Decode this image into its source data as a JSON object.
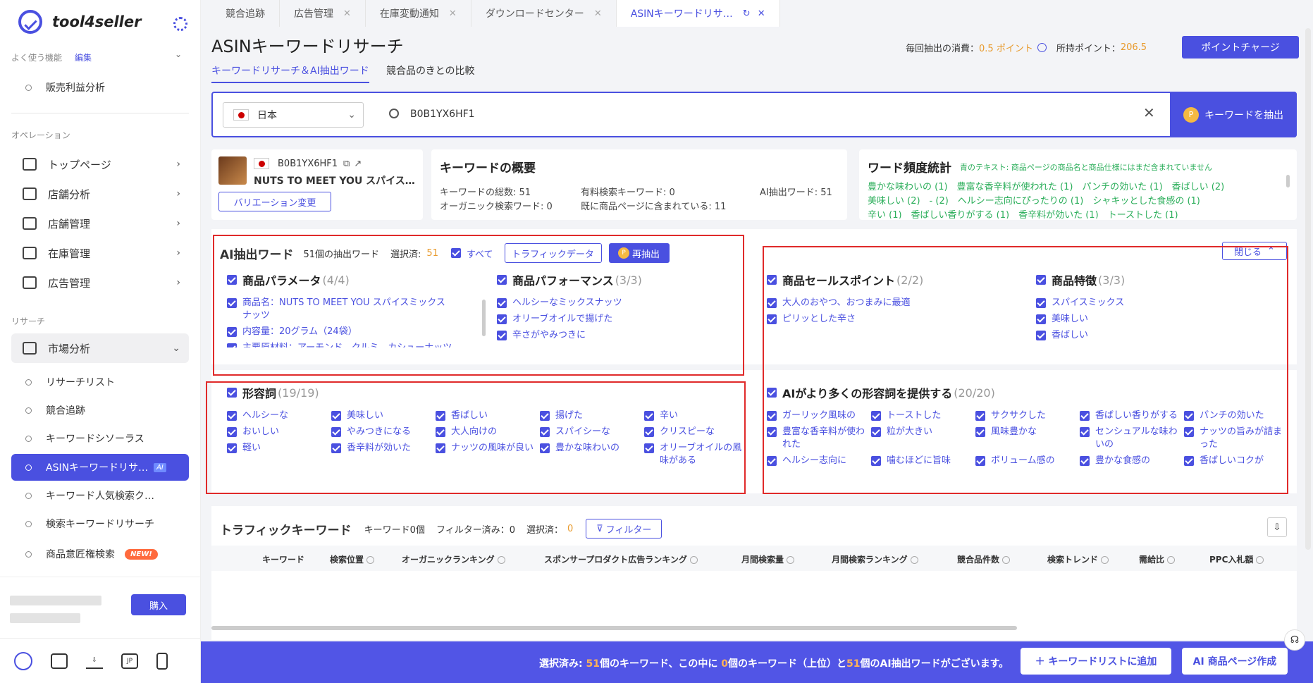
{
  "app": {
    "name": "tool4seller"
  },
  "sidebar": {
    "favorites_label": "よく使う機能",
    "edit_label": "編集",
    "fav_items": [
      {
        "label": "販売利益分析"
      }
    ],
    "operation_label": "オペレーション",
    "op_items": [
      {
        "label": "トップページ",
        "icon": "home-icon"
      },
      {
        "label": "店舗分析",
        "icon": "chart-icon"
      },
      {
        "label": "店舗管理",
        "icon": "store-icon"
      },
      {
        "label": "在庫管理",
        "icon": "box-icon"
      },
      {
        "label": "広告管理",
        "icon": "monitor-icon"
      }
    ],
    "research_label": "リサーチ",
    "market_label": "市場分析",
    "research_items": [
      {
        "label": "リサーチリスト"
      },
      {
        "label": "競合追跡"
      },
      {
        "label": "キーワードシソーラス"
      },
      {
        "label": "ASINキーワードリサ…",
        "tag": "AI"
      },
      {
        "label": "キーワード人気検索ク…"
      },
      {
        "label": "検索キーワードリサーチ"
      },
      {
        "label": "商品意匠権検索",
        "tag": "NEW!"
      }
    ],
    "buy_label": "購入",
    "lang_label": "JP"
  },
  "tabs": [
    {
      "label": "競合追跡"
    },
    {
      "label": "広告管理"
    },
    {
      "label": "在庫変動通知"
    },
    {
      "label": "ダウンロードセンター"
    },
    {
      "label": "ASINキーワードリサ…"
    }
  ],
  "header": {
    "title": "ASINキーワードリサーチ",
    "subtabs": [
      "キーワードリサーチ＆AI抽出ワード",
      "競合品のきとの比較"
    ],
    "cost_label": "毎回抽出の消費：",
    "cost_value": "0.5 ポイント",
    "own_label": "所持ポイント：",
    "own_value": "206.5",
    "charge_label": "ポイントチャージ"
  },
  "search": {
    "country": "日本",
    "query": "B0B1YX6HF1",
    "extract_label": "キーワードを抽出"
  },
  "product": {
    "asin": "B0B1YX6HF1",
    "name": "NUTS TO MEET YOU スパイス…",
    "variation_label": "バリエーション変更"
  },
  "overview": {
    "title": "キーワードの概要",
    "total_label": "キーワードの総数:",
    "total": "51",
    "paid_label": "有料検索キーワード:",
    "paid": "0",
    "ai_label": "AI抽出ワード:",
    "ai": "51",
    "organic_label": "オーガニック検索ワード:",
    "organic": "0",
    "included_label": "既に商品ページに含まれている:",
    "included": "11"
  },
  "freq": {
    "title": "ワード頻度統計",
    "note": "青のテキスト: 商品ページの商品名と商品仕様にはまだ含まれていません",
    "rows": [
      "豊かな味わいの (1)　豊富な香辛料が使われた (1)　パンチの効いた (1)　香ばしい (2)",
      "美味しい (2)　- (2)　ヘルシー志向にぴったりの (1)　シャキッとした食感の (1)",
      "辛い (1)　香ばしい香りがする (1)　香辛料が効いた (1)　トーストした (1)"
    ]
  },
  "ai": {
    "title": "AI抽出ワード",
    "count_label": "51個の抽出ワード",
    "selected_label": "選択済:",
    "selected": "51",
    "all_label": "すべて",
    "traffic_btn": "トラフィックデータ",
    "reextract_btn": "再抽出",
    "close_label": "閉じる"
  },
  "panels": {
    "params": {
      "title": "商品パラメータ",
      "count": "(4/4)",
      "items": [
        "商品名：NUTS TO MEET YOU スパイスミックスナッツ",
        "内容量：20グラム（24袋）",
        "主要原材料：アーモンド、クルミ、カシューナッツ"
      ]
    },
    "perf": {
      "title": "商品パフォーマンス",
      "count": "(3/3)",
      "items": [
        "ヘルシーなミックスナッツ",
        "オリーブオイルで揚げた",
        "辛さがやみつきに"
      ]
    },
    "sales": {
      "title": "商品セールスポイント",
      "count": "(2/2)",
      "items": [
        "大人のおやつ、おつまみに最適",
        "ピリッとした辛さ"
      ]
    },
    "feat": {
      "title": "商品特徴",
      "count": "(3/3)",
      "items": [
        "スパイスミックス",
        "美味しい",
        "香ばしい"
      ]
    },
    "adj": {
      "title": "形容詞",
      "count": "(19/19)",
      "items": [
        "ヘルシーな",
        "美味しい",
        "香ばしい",
        "揚げた",
        "辛い",
        "おいしい",
        "やみつきになる",
        "大人向けの",
        "スパイシーな",
        "クリスピーな",
        "軽い",
        "香辛料が効いた",
        "ナッツの風味が良い",
        "豊かな味わいの",
        "オリーブオイルの風味がある"
      ]
    },
    "aiadj": {
      "title": "AIがより多くの形容詞を提供する",
      "count": "(20/20)",
      "items": [
        "ガーリック風味の",
        "トーストした",
        "サクサクした",
        "香ばしい香りがする",
        "パンチの効いた",
        "豊富な香辛料が使われた",
        "粒が大きい",
        "風味豊かな",
        "センシュアルな味わいの",
        "ナッツの旨みが詰まった",
        "ヘルシー志向に",
        "噛むほどに旨味",
        "ボリューム感の",
        "豊かな食感の",
        "香ばしいコクが"
      ]
    }
  },
  "traffic": {
    "title": "トラフィックキーワード",
    "count_label": "キーワード0個",
    "filtered_label": "フィルター済み：0",
    "selected_label": "選択済：",
    "selected": "0",
    "filter_btn": "フィルター",
    "columns": [
      "キーワード",
      "検索位置",
      "オーガニックランキング",
      "スポンサープロダクト広告ランキング",
      "月間検索量",
      "月間検索ランキング",
      "競合品件数",
      "検索トレンド",
      "需給比",
      "PPC入札額"
    ]
  },
  "bottom": {
    "text_a": "選択済み: ",
    "n1": "51",
    "text_b": "個のキーワード、この中に ",
    "n2": "0",
    "text_c": "個のキーワード（上位）と",
    "n3": "51",
    "text_d": "個のAI抽出ワードがございます。",
    "add_btn": "＋ キーワードリストに追加",
    "ai_btn": "AI 商品ページ作成"
  },
  "colors": {
    "accent": "#4a50e0",
    "orange": "#e89a2c",
    "green": "#2bae5a",
    "red_box": "#e02a2a"
  }
}
